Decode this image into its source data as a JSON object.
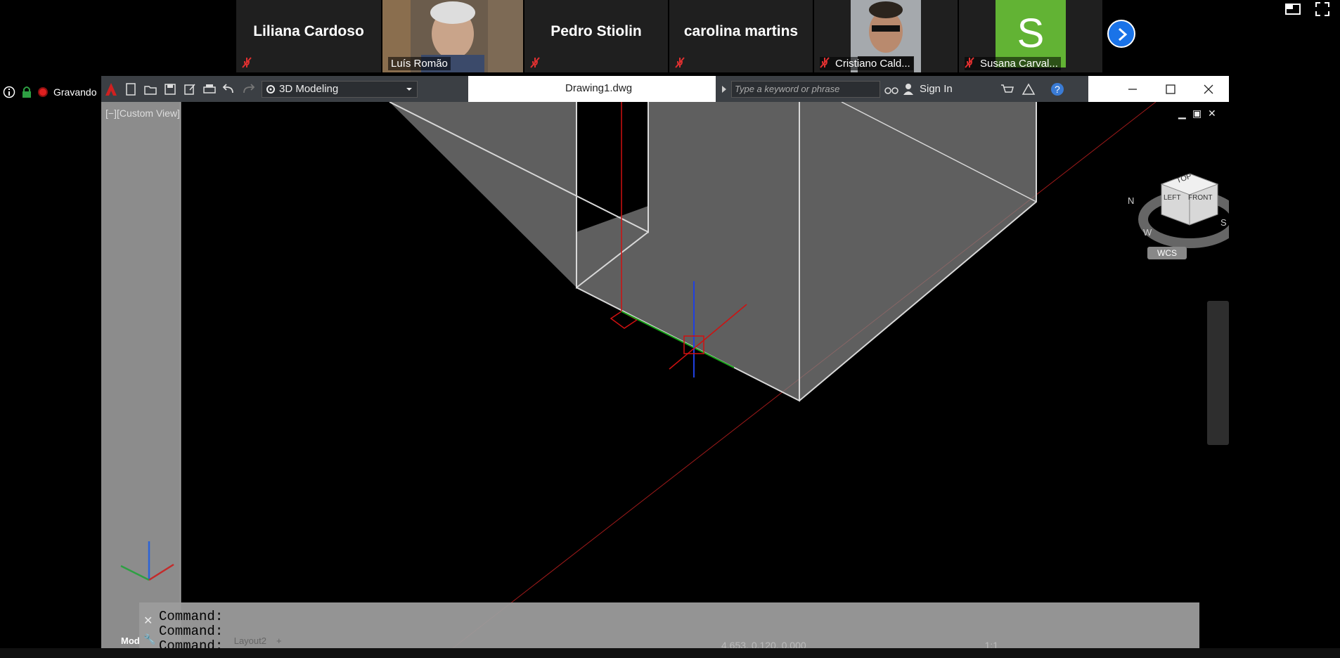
{
  "meeting": {
    "participants": [
      {
        "name": "Liliana Cardoso",
        "video": false,
        "muted": true
      },
      {
        "name": "Luís Romão",
        "video": true,
        "muted": false
      },
      {
        "name": "Pedro Stiolin",
        "video": false,
        "muted": true
      },
      {
        "name": "carolina martins",
        "video": false,
        "muted": true
      },
      {
        "name": "Cristiano Cald...",
        "video": true,
        "muted": true
      },
      {
        "name": "Susana Carval...",
        "avatar_letter": "S",
        "muted": true
      }
    ],
    "recording_label": "Gravando",
    "next_icon": "chevron-right-icon"
  },
  "autocad": {
    "workspace": "3D Modeling",
    "document_title": "Drawing1.dwg",
    "search_placeholder": "Type a keyword or phrase",
    "sign_in": "Sign In",
    "view_label": "[−][Custom View]",
    "viewcube": {
      "top": "TOP",
      "left": "LEFT",
      "front": "FRONT",
      "compass": [
        "N",
        "S",
        "W"
      ],
      "ucs": "WCS"
    },
    "command_lines": [
      "Command:",
      "Command:",
      "Command:"
    ],
    "layout_tabs": [
      "Mod",
      "Layout2",
      "+"
    ],
    "coordinates": "4.653, 0.120, 0.000",
    "scale": "1:1"
  },
  "colors": {
    "zoom_tile": "#1f1f1f",
    "avatar_green": "#62b334",
    "accent_blue": "#1a73e8",
    "record_red": "#e02020",
    "acad_toolbar": "#3b3f44"
  }
}
